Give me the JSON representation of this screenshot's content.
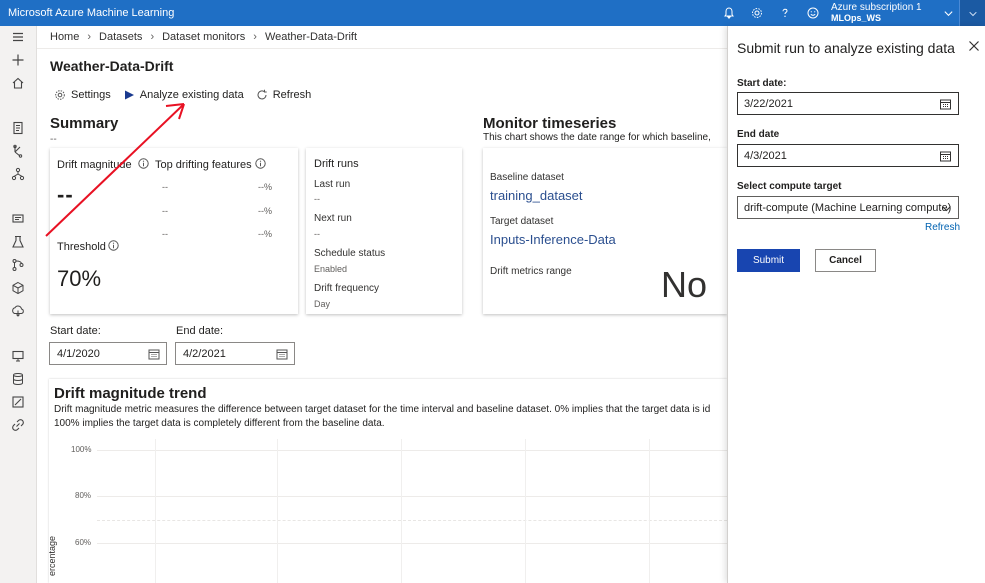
{
  "topbar": {
    "app_title": "Microsoft Azure Machine Learning",
    "subscription": "Azure subscription 1",
    "workspace": "MLOps_WS",
    "icons": [
      "bell-icon",
      "gear-icon",
      "help-icon",
      "smiley-icon",
      "chevron-down-icon",
      "avatar-icon"
    ]
  },
  "leftnav": {
    "icons": [
      "hamburger-icon",
      "plus-icon",
      "home-icon",
      "notebook-icon",
      "automl-icon",
      "designer-icon",
      "datasets-icon",
      "experiments-icon",
      "pipelines-icon",
      "models-icon",
      "endpoints-icon",
      "compute-icon",
      "datastores-icon",
      "labeling-icon",
      "linked-services-icon"
    ]
  },
  "breadcrumb": {
    "items": [
      "Home",
      "Datasets",
      "Dataset monitors",
      "Weather-Data-Drift"
    ]
  },
  "page": {
    "title": "Weather-Data-Drift"
  },
  "toolbar": {
    "settings": "Settings",
    "analyze": "Analyze existing data",
    "refresh": "Refresh"
  },
  "summary": {
    "heading": "Summary",
    "sub": "--",
    "drift_magnitude_label": "Drift magnitude",
    "drift_magnitude_value": "--",
    "top_features_label": "Top drifting features",
    "features": [
      {
        "name": "--",
        "pct": "--%"
      },
      {
        "name": "--",
        "pct": "--%"
      },
      {
        "name": "--",
        "pct": "--%"
      }
    ],
    "threshold_label": "Threshold",
    "threshold_value": "70%"
  },
  "drift_runs": {
    "heading": "Drift runs",
    "last_run_label": "Last run",
    "last_run_value": "--",
    "next_run_label": "Next run",
    "next_run_value": "--",
    "schedule_status_label": "Schedule status",
    "schedule_status_value": "Enabled",
    "drift_frequency_label": "Drift frequency",
    "drift_frequency_value": "Day"
  },
  "monitor": {
    "heading": "Monitor timeseries",
    "description": "This chart shows the date range for which baseline,",
    "baseline_label": "Baseline dataset",
    "baseline_value": "training_dataset",
    "target_label": "Target dataset",
    "target_value": "Inputs-Inference-Data",
    "metrics_label": "Drift metrics range",
    "no_text": "No"
  },
  "dates": {
    "start_label": "Start date:",
    "start_value": "4/1/2020",
    "end_label": "End date:",
    "end_value": "4/2/2021"
  },
  "trend": {
    "heading": "Drift magnitude trend",
    "description_1": "Drift magnitude metric measures the difference between target dataset for the time interval and baseline dataset. 0% implies that the target data is id",
    "description_2": "100% implies the target data is completely different from the baseline data.",
    "y_ticks": [
      "100%",
      "80%",
      "60%"
    ],
    "y_axis_label": "ercentage"
  },
  "panel": {
    "title": "Submit run to analyze existing data",
    "start_label": "Start date:",
    "start_value": "3/22/2021",
    "end_label": "End date",
    "end_value": "4/3/2021",
    "compute_label": "Select compute target",
    "compute_value": "drift-compute (Machine Learning compute)",
    "refresh_link": "Refresh",
    "submit": "Submit",
    "cancel": "Cancel"
  },
  "colors": {
    "topbar": "#1f6fc5",
    "primary_button": "#1845b0",
    "link": "#0062b1",
    "arrow": "#e81123"
  }
}
